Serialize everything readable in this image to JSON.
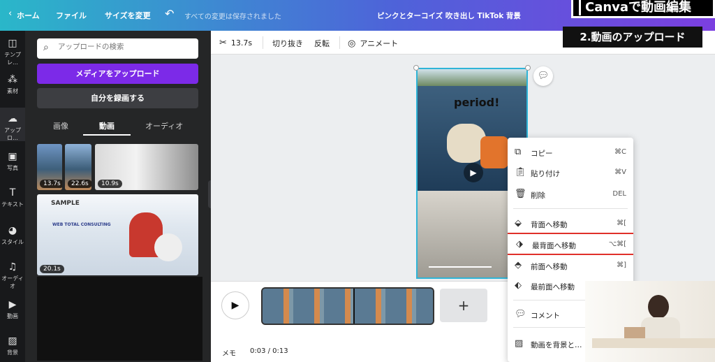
{
  "topbar": {
    "home": "ホーム",
    "file": "ファイル",
    "resize": "サイズを変更",
    "saved_status": "すべての変更は保存されました",
    "doc_title": "ピンクとターコイズ 吹き出し TikTok 背景",
    "overlay_title": "Canvaで動画編集"
  },
  "rail": {
    "items": [
      {
        "label": "テンプレ…",
        "icon": "layout-icon"
      },
      {
        "label": "素材",
        "icon": "elements-icon"
      },
      {
        "label": "アップロ…",
        "icon": "upload-icon"
      },
      {
        "label": "写真",
        "icon": "photo-icon"
      },
      {
        "label": "テキスト",
        "icon": "text-icon"
      },
      {
        "label": "スタイル",
        "icon": "palette-icon"
      },
      {
        "label": "オーディオ",
        "icon": "audio-icon"
      },
      {
        "label": "動画",
        "icon": "video-icon"
      },
      {
        "label": "背景",
        "icon": "background-icon"
      }
    ]
  },
  "panel": {
    "search_placeholder": "アップロードの検索",
    "upload_button": "メディアをアップロード",
    "record_button": "自分を録画する",
    "tabs": [
      "画像",
      "動画",
      "オーディオ"
    ],
    "thumbnails": [
      {
        "duration": "13.7s"
      },
      {
        "duration": "22.6s"
      },
      {
        "duration": "10.9s"
      },
      {
        "duration": "20.1s",
        "title": "SAMPLE",
        "subtitle": "WEB TOTAL CONSULTING"
      }
    ]
  },
  "toolbar": {
    "duration": "13.7s",
    "crop": "切り抜き",
    "flip": "反転",
    "animate": "アニメート",
    "overlay_subtitle": "2.動画のアップロード"
  },
  "canvas": {
    "caption": "period!"
  },
  "context_menu": {
    "items": [
      {
        "label": "コピー",
        "shortcut": "⌘C",
        "icon": "copy-icon"
      },
      {
        "label": "貼り付け",
        "shortcut": "⌘V",
        "icon": "paste-icon"
      },
      {
        "label": "削除",
        "shortcut": "DEL",
        "icon": "trash-icon"
      },
      {
        "label": "背面へ移動",
        "shortcut": "⌘[",
        "icon": "send-backward-icon"
      },
      {
        "label": "最背面へ移動",
        "shortcut": "⌥⌘[",
        "icon": "send-to-back-icon"
      },
      {
        "label": "前面へ移動",
        "shortcut": "⌘]",
        "icon": "bring-forward-icon"
      },
      {
        "label": "最前面へ移動",
        "shortcut": "",
        "icon": "bring-to-front-icon"
      },
      {
        "label": "コメント",
        "shortcut": "",
        "icon": "comment-icon"
      },
      {
        "label": "動画を背景と…",
        "shortcut": "",
        "icon": "background-icon"
      }
    ]
  },
  "timeline": {
    "memo": "メモ",
    "time": "0:03 / 0:13"
  }
}
